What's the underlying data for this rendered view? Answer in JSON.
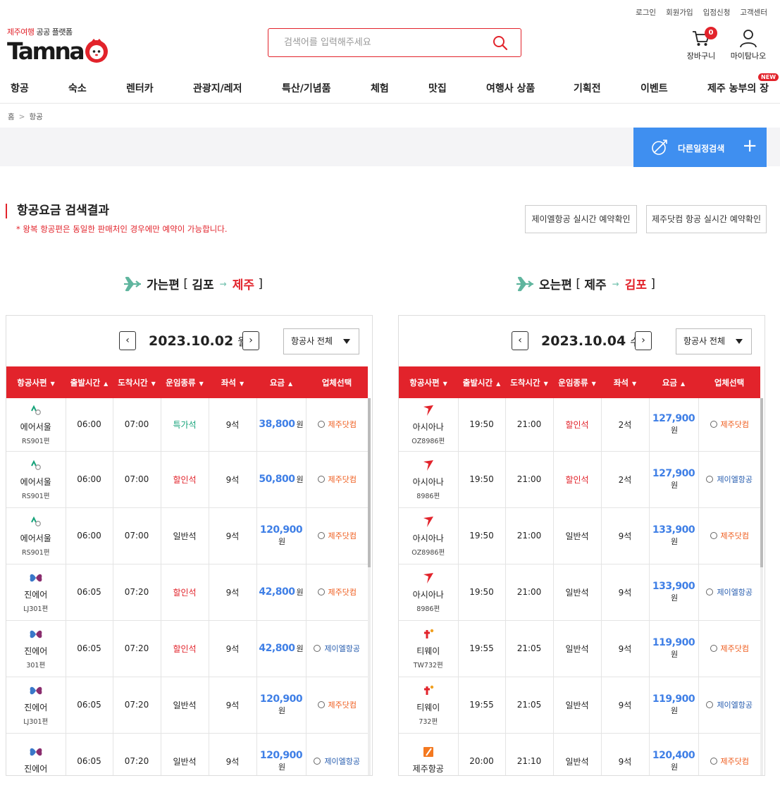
{
  "util_links": [
    "로그인",
    "회원가입",
    "입점신청",
    "고객센터"
  ],
  "logo": {
    "sub_red": "제주여행",
    "sub_rest": "공공 플랫폼",
    "word": "Tamna"
  },
  "search": {
    "placeholder": "검색어를 입력해주세요"
  },
  "header_icons": {
    "cart_label": "장바구니",
    "cart_count": "0",
    "my_label": "마이탐나오"
  },
  "gnb": [
    "항공",
    "숙소",
    "렌터카",
    "관광지/레저",
    "특산/기념품",
    "체험",
    "맛집",
    "여행사 상품",
    "기획전",
    "이벤트",
    "제주 농부의 장"
  ],
  "gnb_new_badge": "NEW",
  "breadcrumb": [
    "홈",
    "항공"
  ],
  "other_schedule_button": "다른일정검색",
  "result": {
    "title": "항공요금 검색결과",
    "note": "* 왕복 항공편은 동일한 판매처인 경우에만 예약이 가능합니다.",
    "check_jeil": "제이엘항공 실시간 예약확인",
    "check_jeju": "제주닷컴 항공 실시간 예약확인"
  },
  "outbound": {
    "label": "가는편",
    "from": "김포",
    "to": "제주",
    "date": "2023.10.02",
    "dow": "월",
    "airline_filter": "항공사 전체"
  },
  "inbound": {
    "label": "오는편",
    "from": "제주",
    "to": "김포",
    "date": "2023.10.04",
    "dow": "수",
    "airline_filter": "항공사 전체"
  },
  "table_headers": [
    "항공사편",
    "출발시간",
    "도착시간",
    "운임종류",
    "좌석",
    "요금",
    "업체선택"
  ],
  "header_sort": [
    "▼",
    "▲",
    "▼",
    "▼",
    "▼",
    "▲",
    ""
  ],
  "out_flights": [
    {
      "logo": "airseoul",
      "airline": "에어서울",
      "code": "RS901편",
      "dep": "06:00",
      "arr": "07:00",
      "fare": "특가석",
      "fare_type": "special",
      "seats": "9석",
      "price": "38,800",
      "vendor": "제주닷컴",
      "vendor_type": "jeju"
    },
    {
      "logo": "airseoul",
      "airline": "에어서울",
      "code": "RS901편",
      "dep": "06:00",
      "arr": "07:00",
      "fare": "할인석",
      "fare_type": "discount",
      "seats": "9석",
      "price": "50,800",
      "vendor": "제주닷컴",
      "vendor_type": "jeju"
    },
    {
      "logo": "airseoul",
      "airline": "에어서울",
      "code": "RS901편",
      "dep": "06:00",
      "arr": "07:00",
      "fare": "일반석",
      "fare_type": "normal",
      "seats": "9석",
      "price": "120,900",
      "vendor": "제주닷컴",
      "vendor_type": "jeju"
    },
    {
      "logo": "jinair",
      "airline": "진에어",
      "code": "LJ301편",
      "dep": "06:05",
      "arr": "07:20",
      "fare": "할인석",
      "fare_type": "discount",
      "seats": "9석",
      "price": "42,800",
      "vendor": "제주닷컴",
      "vendor_type": "jeju"
    },
    {
      "logo": "jinair",
      "airline": "진에어",
      "code": "301편",
      "dep": "06:05",
      "arr": "07:20",
      "fare": "할인석",
      "fare_type": "discount",
      "seats": "9석",
      "price": "42,800",
      "vendor": "제이엘항공",
      "vendor_type": "jeil"
    },
    {
      "logo": "jinair",
      "airline": "진에어",
      "code": "LJ301편",
      "dep": "06:05",
      "arr": "07:20",
      "fare": "일반석",
      "fare_type": "normal",
      "seats": "9석",
      "price": "120,900",
      "vendor": "제주닷컴",
      "vendor_type": "jeju"
    },
    {
      "logo": "jinair",
      "airline": "진에어",
      "code": "",
      "dep": "06:05",
      "arr": "07:20",
      "fare": "일반석",
      "fare_type": "normal",
      "seats": "9석",
      "price": "120,900",
      "vendor": "제이엘항공",
      "vendor_type": "jeil"
    }
  ],
  "in_flights": [
    {
      "logo": "asiana",
      "airline": "아시아나",
      "code": "OZ8986편",
      "dep": "19:50",
      "arr": "21:00",
      "fare": "할인석",
      "fare_type": "discount",
      "seats": "2석",
      "price": "127,900",
      "vendor": "제주닷컴",
      "vendor_type": "jeju"
    },
    {
      "logo": "asiana",
      "airline": "아시아나",
      "code": "8986편",
      "dep": "19:50",
      "arr": "21:00",
      "fare": "할인석",
      "fare_type": "discount",
      "seats": "2석",
      "price": "127,900",
      "vendor": "제이엘항공",
      "vendor_type": "jeil"
    },
    {
      "logo": "asiana",
      "airline": "아시아나",
      "code": "OZ8986편",
      "dep": "19:50",
      "arr": "21:00",
      "fare": "일반석",
      "fare_type": "normal",
      "seats": "9석",
      "price": "133,900",
      "vendor": "제주닷컴",
      "vendor_type": "jeju"
    },
    {
      "logo": "asiana",
      "airline": "아시아나",
      "code": "8986편",
      "dep": "19:50",
      "arr": "21:00",
      "fare": "일반석",
      "fare_type": "normal",
      "seats": "9석",
      "price": "133,900",
      "vendor": "제이엘항공",
      "vendor_type": "jeil"
    },
    {
      "logo": "tway",
      "airline": "티웨이",
      "code": "TW732편",
      "dep": "19:55",
      "arr": "21:05",
      "fare": "일반석",
      "fare_type": "normal",
      "seats": "9석",
      "price": "119,900",
      "vendor": "제주닷컴",
      "vendor_type": "jeju"
    },
    {
      "logo": "tway",
      "airline": "티웨이",
      "code": "732편",
      "dep": "19:55",
      "arr": "21:05",
      "fare": "일반석",
      "fare_type": "normal",
      "seats": "9석",
      "price": "119,900",
      "vendor": "제이엘항공",
      "vendor_type": "jeil"
    },
    {
      "logo": "jejuair",
      "airline": "제주항공",
      "code": "",
      "dep": "20:00",
      "arr": "21:10",
      "fare": "일반석",
      "fare_type": "normal",
      "seats": "9석",
      "price": "120,400",
      "vendor": "제주닷컴",
      "vendor_type": "jeju"
    }
  ],
  "price_unit": "원",
  "colors": {
    "brand_red": "#e2232b",
    "price_blue": "#3f7fe6",
    "button_blue": "#3f8ff0",
    "special_green": "#16a37a",
    "vendor_orange": "#ef5b1b",
    "vendor_navy": "#2a5fb0"
  },
  "icons": [
    "search-icon",
    "cart-icon",
    "user-icon",
    "plane-icon",
    "chevron-left-icon",
    "chevron-right-icon",
    "caret-down-icon",
    "plus-icon"
  ]
}
